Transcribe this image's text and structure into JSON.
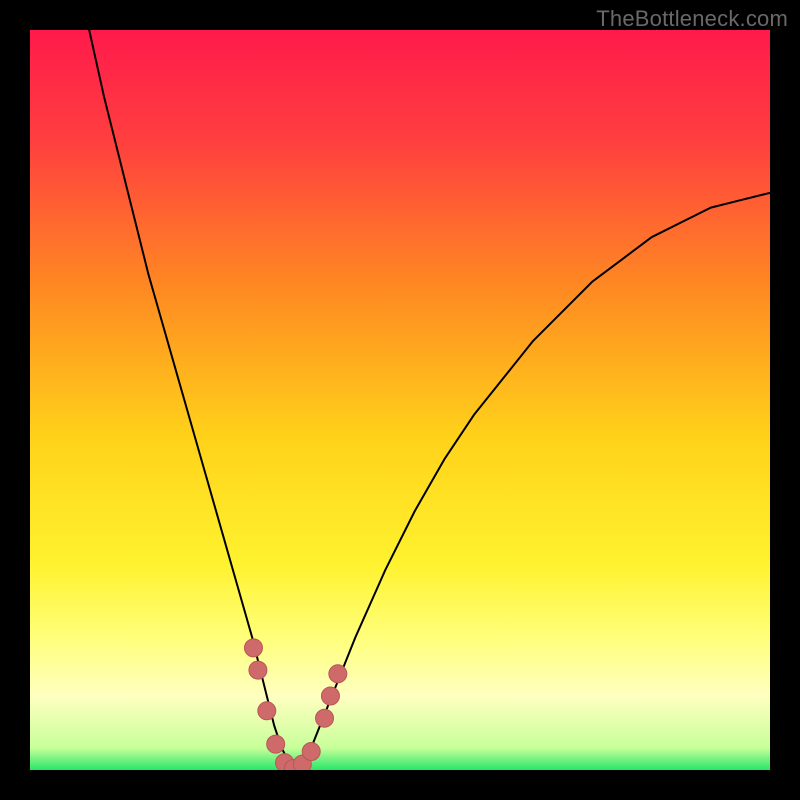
{
  "watermark": "TheBottleneck.com",
  "chart_data": {
    "type": "line",
    "title": "",
    "xlabel": "",
    "ylabel": "",
    "xlim": [
      0,
      100
    ],
    "ylim": [
      0,
      100
    ],
    "grid": false,
    "legend": false,
    "gradient_stops": [
      {
        "offset": 0.0,
        "color": "#ff1a4b"
      },
      {
        "offset": 0.15,
        "color": "#ff3f3f"
      },
      {
        "offset": 0.35,
        "color": "#ff8a22"
      },
      {
        "offset": 0.55,
        "color": "#ffd21a"
      },
      {
        "offset": 0.72,
        "color": "#fff22e"
      },
      {
        "offset": 0.82,
        "color": "#ffff7a"
      },
      {
        "offset": 0.9,
        "color": "#ffffc0"
      },
      {
        "offset": 0.97,
        "color": "#c8ff9a"
      },
      {
        "offset": 1.0,
        "color": "#28e76a"
      }
    ],
    "series": [
      {
        "name": "bottleneck-curve",
        "stroke": "#000000",
        "stroke_width": 2.0,
        "x": [
          8,
          10,
          12,
          14,
          16,
          18,
          20,
          22,
          24,
          26,
          28,
          30,
          31,
          32,
          33,
          34,
          35,
          36,
          37,
          38,
          40,
          42,
          44,
          48,
          52,
          56,
          60,
          64,
          68,
          72,
          76,
          80,
          84,
          88,
          92,
          96,
          100
        ],
        "y": [
          100,
          91,
          83,
          75,
          67,
          60,
          53,
          46,
          39,
          32,
          25,
          18,
          14,
          10,
          6,
          3,
          1,
          0,
          1,
          3,
          8,
          13,
          18,
          27,
          35,
          42,
          48,
          53,
          58,
          62,
          66,
          69,
          72,
          74,
          76,
          77,
          78
        ]
      }
    ],
    "markers": {
      "name": "threshold-dots",
      "fill": "#cf6a6a",
      "stroke": "#b95656",
      "radius": 9,
      "points": [
        {
          "x": 30.2,
          "y": 16.5
        },
        {
          "x": 30.8,
          "y": 13.5
        },
        {
          "x": 32.0,
          "y": 8.0
        },
        {
          "x": 33.2,
          "y": 3.5
        },
        {
          "x": 34.4,
          "y": 1.0
        },
        {
          "x": 35.6,
          "y": 0.2
        },
        {
          "x": 36.8,
          "y": 0.8
        },
        {
          "x": 38.0,
          "y": 2.5
        },
        {
          "x": 39.8,
          "y": 7.0
        },
        {
          "x": 40.6,
          "y": 10.0
        },
        {
          "x": 41.6,
          "y": 13.0
        }
      ]
    }
  }
}
